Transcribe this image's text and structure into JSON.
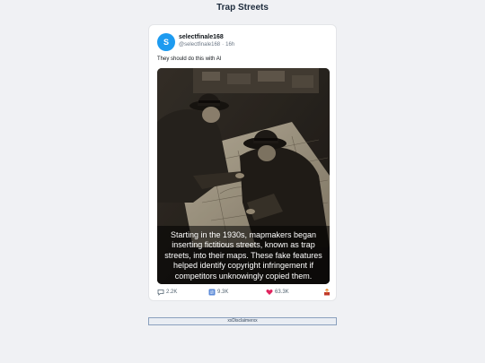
{
  "page": {
    "title": "Trap Streets"
  },
  "post": {
    "avatar_letter": "S",
    "display_name": "selectfinale168",
    "handle": "@selectfinale168",
    "time": "16h",
    "text": "They should do this with AI",
    "image_caption": "Starting in the 1930s, mapmakers began inserting fictitious streets, known as trap streets, into their maps. These fake features helped identify copyright infringement if competitors unknowingly copied them.",
    "stats": {
      "replies": "2.2K",
      "retweets": "9.3K",
      "likes": "63.3K"
    }
  },
  "footer": {
    "disclaimer": "xxDisclaimerxx"
  },
  "colors": {
    "accent": "#1d9bf0",
    "like": "#e0245e",
    "background": "#f0f1f4"
  },
  "icons": {
    "reply": "speech-bubble-icon",
    "retweet": "retweet-icon",
    "like": "heart-icon",
    "share": "share-icon"
  }
}
